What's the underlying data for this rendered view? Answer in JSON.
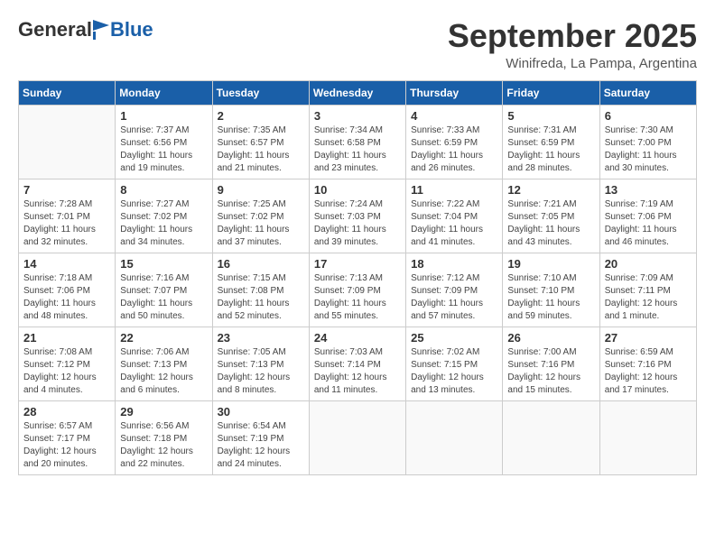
{
  "logo": {
    "general": "General",
    "blue": "Blue"
  },
  "header": {
    "month": "September 2025",
    "location": "Winifreda, La Pampa, Argentina"
  },
  "weekdays": [
    "Sunday",
    "Monday",
    "Tuesday",
    "Wednesday",
    "Thursday",
    "Friday",
    "Saturday"
  ],
  "weeks": [
    [
      {
        "day": "",
        "info": ""
      },
      {
        "day": "1",
        "info": "Sunrise: 7:37 AM\nSunset: 6:56 PM\nDaylight: 11 hours\nand 19 minutes."
      },
      {
        "day": "2",
        "info": "Sunrise: 7:35 AM\nSunset: 6:57 PM\nDaylight: 11 hours\nand 21 minutes."
      },
      {
        "day": "3",
        "info": "Sunrise: 7:34 AM\nSunset: 6:58 PM\nDaylight: 11 hours\nand 23 minutes."
      },
      {
        "day": "4",
        "info": "Sunrise: 7:33 AM\nSunset: 6:59 PM\nDaylight: 11 hours\nand 26 minutes."
      },
      {
        "day": "5",
        "info": "Sunrise: 7:31 AM\nSunset: 6:59 PM\nDaylight: 11 hours\nand 28 minutes."
      },
      {
        "day": "6",
        "info": "Sunrise: 7:30 AM\nSunset: 7:00 PM\nDaylight: 11 hours\nand 30 minutes."
      }
    ],
    [
      {
        "day": "7",
        "info": "Sunrise: 7:28 AM\nSunset: 7:01 PM\nDaylight: 11 hours\nand 32 minutes."
      },
      {
        "day": "8",
        "info": "Sunrise: 7:27 AM\nSunset: 7:02 PM\nDaylight: 11 hours\nand 34 minutes."
      },
      {
        "day": "9",
        "info": "Sunrise: 7:25 AM\nSunset: 7:02 PM\nDaylight: 11 hours\nand 37 minutes."
      },
      {
        "day": "10",
        "info": "Sunrise: 7:24 AM\nSunset: 7:03 PM\nDaylight: 11 hours\nand 39 minutes."
      },
      {
        "day": "11",
        "info": "Sunrise: 7:22 AM\nSunset: 7:04 PM\nDaylight: 11 hours\nand 41 minutes."
      },
      {
        "day": "12",
        "info": "Sunrise: 7:21 AM\nSunset: 7:05 PM\nDaylight: 11 hours\nand 43 minutes."
      },
      {
        "day": "13",
        "info": "Sunrise: 7:19 AM\nSunset: 7:06 PM\nDaylight: 11 hours\nand 46 minutes."
      }
    ],
    [
      {
        "day": "14",
        "info": "Sunrise: 7:18 AM\nSunset: 7:06 PM\nDaylight: 11 hours\nand 48 minutes."
      },
      {
        "day": "15",
        "info": "Sunrise: 7:16 AM\nSunset: 7:07 PM\nDaylight: 11 hours\nand 50 minutes."
      },
      {
        "day": "16",
        "info": "Sunrise: 7:15 AM\nSunset: 7:08 PM\nDaylight: 11 hours\nand 52 minutes."
      },
      {
        "day": "17",
        "info": "Sunrise: 7:13 AM\nSunset: 7:09 PM\nDaylight: 11 hours\nand 55 minutes."
      },
      {
        "day": "18",
        "info": "Sunrise: 7:12 AM\nSunset: 7:09 PM\nDaylight: 11 hours\nand 57 minutes."
      },
      {
        "day": "19",
        "info": "Sunrise: 7:10 AM\nSunset: 7:10 PM\nDaylight: 11 hours\nand 59 minutes."
      },
      {
        "day": "20",
        "info": "Sunrise: 7:09 AM\nSunset: 7:11 PM\nDaylight: 12 hours\nand 1 minute."
      }
    ],
    [
      {
        "day": "21",
        "info": "Sunrise: 7:08 AM\nSunset: 7:12 PM\nDaylight: 12 hours\nand 4 minutes."
      },
      {
        "day": "22",
        "info": "Sunrise: 7:06 AM\nSunset: 7:13 PM\nDaylight: 12 hours\nand 6 minutes."
      },
      {
        "day": "23",
        "info": "Sunrise: 7:05 AM\nSunset: 7:13 PM\nDaylight: 12 hours\nand 8 minutes."
      },
      {
        "day": "24",
        "info": "Sunrise: 7:03 AM\nSunset: 7:14 PM\nDaylight: 12 hours\nand 11 minutes."
      },
      {
        "day": "25",
        "info": "Sunrise: 7:02 AM\nSunset: 7:15 PM\nDaylight: 12 hours\nand 13 minutes."
      },
      {
        "day": "26",
        "info": "Sunrise: 7:00 AM\nSunset: 7:16 PM\nDaylight: 12 hours\nand 15 minutes."
      },
      {
        "day": "27",
        "info": "Sunrise: 6:59 AM\nSunset: 7:16 PM\nDaylight: 12 hours\nand 17 minutes."
      }
    ],
    [
      {
        "day": "28",
        "info": "Sunrise: 6:57 AM\nSunset: 7:17 PM\nDaylight: 12 hours\nand 20 minutes."
      },
      {
        "day": "29",
        "info": "Sunrise: 6:56 AM\nSunset: 7:18 PM\nDaylight: 12 hours\nand 22 minutes."
      },
      {
        "day": "30",
        "info": "Sunrise: 6:54 AM\nSunset: 7:19 PM\nDaylight: 12 hours\nand 24 minutes."
      },
      {
        "day": "",
        "info": ""
      },
      {
        "day": "",
        "info": ""
      },
      {
        "day": "",
        "info": ""
      },
      {
        "day": "",
        "info": ""
      }
    ]
  ]
}
